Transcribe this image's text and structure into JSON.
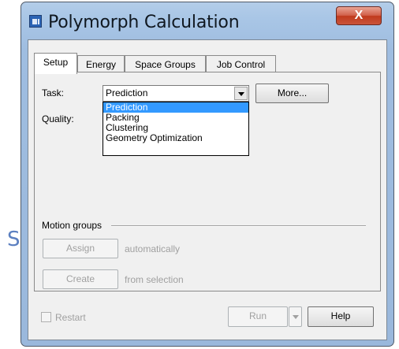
{
  "stray_glyph": "S",
  "window": {
    "title": "Polymorph Calculation",
    "close_label": "X"
  },
  "tabs": [
    {
      "label": "Setup",
      "active": true
    },
    {
      "label": "Energy",
      "active": false
    },
    {
      "label": "Space Groups",
      "active": false
    },
    {
      "label": "Job Control",
      "active": false
    }
  ],
  "setup": {
    "task_label": "Task:",
    "task_value": "Prediction",
    "more_button": "More...",
    "quality_label": "Quality:",
    "task_options": [
      "Prediction",
      "Packing",
      "Clustering",
      "Geometry Optimization"
    ],
    "selected_option": "Prediction",
    "motion_groups_label": "Motion groups",
    "assign_button": "Assign",
    "assign_caption": "automatically",
    "create_button": "Create",
    "create_caption": "from selection"
  },
  "footer": {
    "restart_label": "Restart",
    "run_button": "Run",
    "help_button": "Help"
  },
  "colors": {
    "selection": "#3399ff",
    "close_button": "#c74a31",
    "disabled_text": "#a0a0a0"
  }
}
